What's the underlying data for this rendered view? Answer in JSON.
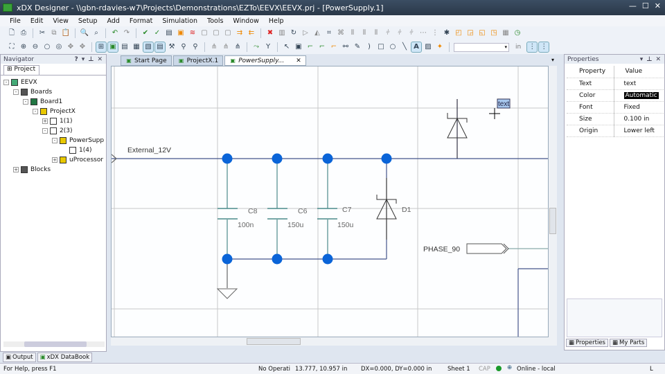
{
  "window": {
    "title": "xDX Designer - \\\\gbn-rdavies-w7\\Projects\\Demonstrations\\EZTo\\EEVX\\EEVX.prj - [PowerSupply.1]"
  },
  "menu": [
    "File",
    "Edit",
    "View",
    "Setup",
    "Add",
    "Format",
    "Simulation",
    "Tools",
    "Window",
    "Help"
  ],
  "toolbar": {
    "units": "in",
    "zoom_value": ""
  },
  "navigator": {
    "title": "Navigator",
    "tab": "Project",
    "tree": [
      {
        "label": "EEVX",
        "depth": 0,
        "exp": "-",
        "icon": "project-icon"
      },
      {
        "label": "Boards",
        "depth": 1,
        "exp": "-",
        "icon": "hierarchy-icon"
      },
      {
        "label": "Board1",
        "depth": 2,
        "exp": "-",
        "icon": "board-icon"
      },
      {
        "label": "ProjectX",
        "depth": 3,
        "exp": "-",
        "icon": "block-icon"
      },
      {
        "label": "1(1)",
        "depth": 4,
        "exp": "+",
        "icon": "sheet-icon"
      },
      {
        "label": "2(3)",
        "depth": 4,
        "exp": "-",
        "icon": "sheet-icon"
      },
      {
        "label": "PowerSupp",
        "depth": 5,
        "exp": "-",
        "icon": "block-icon"
      },
      {
        "label": "1(4)",
        "depth": 6,
        "exp": "",
        "icon": "sheet-icon"
      },
      {
        "label": "uProcessor",
        "depth": 5,
        "exp": "+",
        "icon": "block-icon"
      },
      {
        "label": "Blocks",
        "depth": 1,
        "exp": "+",
        "icon": "hierarchy-icon"
      }
    ]
  },
  "tabs": [
    {
      "label": "Start Page"
    },
    {
      "label": "ProjectX.1"
    },
    {
      "label": "PowerSupply...",
      "active": true
    }
  ],
  "schematic": {
    "net_label": "External_12V",
    "port_label": "PHASE_90",
    "text_cursor": "text",
    "components": [
      {
        "ref": "C8",
        "value": "100n"
      },
      {
        "ref": "C6",
        "value": "150u"
      },
      {
        "ref": "C7",
        "value": "150u"
      },
      {
        "ref": "D1",
        "value": ""
      }
    ],
    "wire_color": "#44558a",
    "junction_color": "#0a64d8"
  },
  "properties": {
    "title": "Properties",
    "headers": [
      "Property",
      "Value"
    ],
    "rows": [
      {
        "p": "Text",
        "v": "text"
      },
      {
        "p": "Color",
        "v": "Automatic"
      },
      {
        "p": "Font",
        "v": "Fixed"
      },
      {
        "p": "Size",
        "v": "0.100 in"
      },
      {
        "p": "Origin",
        "v": "Lower left"
      }
    ],
    "tabs": [
      "Properties",
      "My Parts"
    ]
  },
  "bottom_tabs": [
    "Output",
    "xDX DataBook"
  ],
  "status": {
    "help": "For Help, press F1",
    "operation": "No Operati",
    "coords": "13.777, 10.957 in",
    "delta": "DX=0.000, DY=0.000 in",
    "sheet": "Sheet 1",
    "cap": "CAP",
    "online": "Online - local",
    "mode": "L"
  }
}
